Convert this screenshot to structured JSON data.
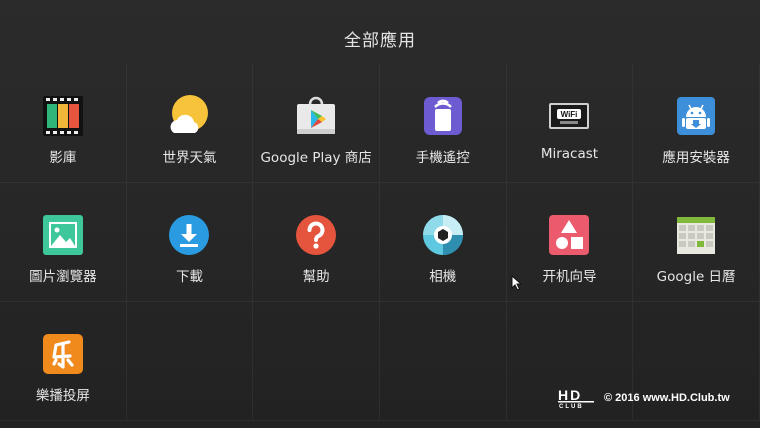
{
  "header": {
    "title": "全部應用"
  },
  "apps": [
    {
      "label": "影庫",
      "icon": "film-icon",
      "name": "app-movie-library"
    },
    {
      "label": "世界天氣",
      "icon": "weather-icon",
      "name": "app-world-weather"
    },
    {
      "label": "Google Play 商店",
      "icon": "play-store-icon",
      "name": "app-google-play-store"
    },
    {
      "label": "手機遙控",
      "icon": "phone-remote-icon",
      "name": "app-phone-remote"
    },
    {
      "label": "Miracast",
      "icon": "miracast-icon",
      "name": "app-miracast"
    },
    {
      "label": "應用安裝器",
      "icon": "android-installer-icon",
      "name": "app-installer"
    },
    {
      "label": "圖片瀏覽器",
      "icon": "picture-icon",
      "name": "app-image-viewer"
    },
    {
      "label": "下載",
      "icon": "download-icon",
      "name": "app-downloads"
    },
    {
      "label": "幫助",
      "icon": "help-icon",
      "name": "app-help"
    },
    {
      "label": "相機",
      "icon": "camera-icon",
      "name": "app-camera"
    },
    {
      "label": "开机向导",
      "icon": "setup-wizard-icon",
      "name": "app-setup-wizard"
    },
    {
      "label": "Google 日曆",
      "icon": "calendar-icon",
      "name": "app-google-calendar"
    },
    {
      "label": "樂播投屏",
      "icon": "lebo-cast-icon",
      "name": "app-lebo-cast"
    }
  ],
  "watermark": {
    "logo": "HD CLUB",
    "text": "© 2016  www.HD.Club.tw"
  },
  "colors": {
    "background": "#282828",
    "installer": "#3d8fd9",
    "picture": "#3ec79a",
    "download": "#2a9be0",
    "help": "#e5553d",
    "setup": "#ec5a6e",
    "lebo": "#f08a1c"
  }
}
